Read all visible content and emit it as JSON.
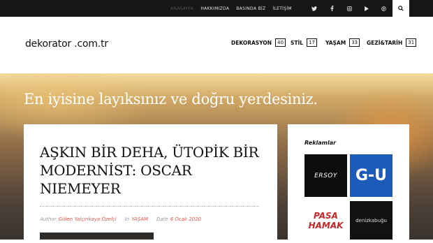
{
  "topbar": {
    "nav": [
      "ANASAYFA",
      "HAKKIMIZDA",
      "BASINDA BİZ",
      "İLETİŞİM"
    ],
    "social_icons": [
      {
        "name": "twitter-icon",
        "glyph": "🐦"
      },
      {
        "name": "facebook-icon",
        "glyph": "f"
      },
      {
        "name": "instagram-icon",
        "glyph": "◎"
      },
      {
        "name": "youtube-icon",
        "glyph": "▶"
      },
      {
        "name": "pinterest-icon",
        "glyph": "℗"
      }
    ],
    "search_icon": "🔍"
  },
  "header": {
    "logo": "dekorator .com.tr",
    "menu": [
      {
        "label": "DEKORASYON",
        "count": "40"
      },
      {
        "label": "STİL",
        "count": "17"
      },
      {
        "label": "YAŞAM",
        "count": "33"
      },
      {
        "label": "GEZİ&TARİH",
        "count": "31"
      }
    ]
  },
  "hero": {
    "tagline": "En iyisine layıksınız ve doğru yerdesiniz."
  },
  "post": {
    "title": "AŞKIN BİR DEHA, ÜTOPİK BİR MODERNİST: OSCAR NIEMEYER",
    "author_label": "Author",
    "author": "Gülen Yalçınkaya Özelçi",
    "in_label": "In",
    "category": "YAŞAM",
    "date_label": "Date",
    "date": "6 Ocak 2020"
  },
  "sidebar": {
    "title": "Reklamlar",
    "ads": [
      "ERSOY",
      "G-U",
      "PASA HAMAK",
      "denizkabuğu"
    ]
  }
}
